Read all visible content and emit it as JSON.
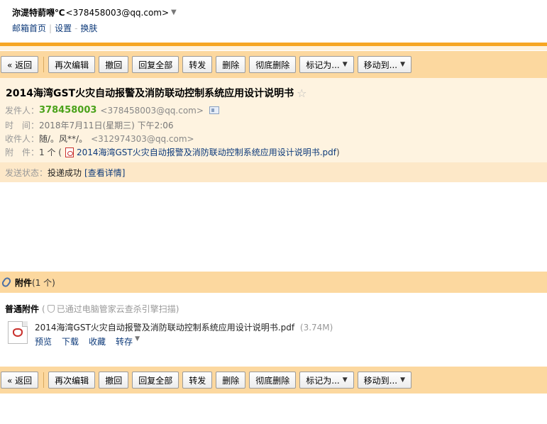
{
  "account": {
    "nickname": "沵湜特葥嘚℃",
    "address": "<378458003@qq.com>",
    "dropdown_glyph": "▼"
  },
  "toplinks": {
    "home": "邮箱首页",
    "separator": "|",
    "settings": "设置",
    "dash": "-",
    "skin": "换肤"
  },
  "toolbar": {
    "back": "« 返回",
    "reedit": "再次编辑",
    "recall": "撤回",
    "reply_all": "回复全部",
    "forward": "转发",
    "delete": "删除",
    "delete_permanent": "彻底删除",
    "mark_as": "标记为...",
    "move_to": "移动到...",
    "caret": "▼"
  },
  "mail": {
    "subject": "2014海湾GST火灾自动报警及消防联动控制系统应用设计说明书",
    "star": "☆",
    "from_label": "发件人：",
    "from_name": "378458003",
    "from_addr": "<378458003@qq.com>",
    "time_label": "时　间：",
    "time_value": "2018年7月11日(星期三) 下午2:06",
    "to_label": "收件人：",
    "to_name": "随/。风**/。",
    "to_addr": "<312974303@qq.com>",
    "attach_label": "附　件：",
    "attach_count": "1 个 (",
    "attach_file": "2014海湾GST火灾自动报警及消防联动控制系统应用设计说明书.pdf",
    "attach_close": ")"
  },
  "status": {
    "label": "发送状态：",
    "value": "投递成功",
    "detail": "[查看详情]"
  },
  "attachments": {
    "title": "附件",
    "count": "(1 个)",
    "normal_title": "普通附件",
    "scan_open": "(",
    "scan_text": "已通过电脑管家云查杀引擎扫描",
    "scan_close": ")",
    "file_name": "2014海湾GST火灾自动报警及消防联动控制系统应用设计说明书.pdf",
    "file_size": "(3.74M)",
    "actions": {
      "preview": "预览",
      "download": "下载",
      "favorite": "收藏",
      "save_to": "转存",
      "caret": "▼"
    }
  },
  "colors": {
    "accent_orange": "#f6a623",
    "toolbar_bg": "#fcd89f",
    "header_bg": "#fef3e0",
    "sender_green": "#4aa21a",
    "link_blue": "#0d3a7a"
  }
}
